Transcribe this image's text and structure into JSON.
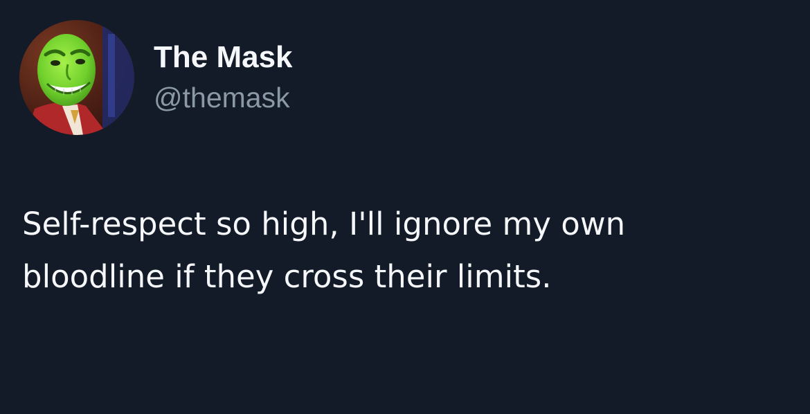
{
  "author": {
    "display_name": "The Mask",
    "handle": "@themask",
    "avatar_icon": "green-mask-face-avatar"
  },
  "tweet": {
    "text": "Self-respect so high, I'll ignore my own\nbloodline if they cross their limits."
  },
  "colors": {
    "background": "#131b28",
    "primary_text": "#f5f7fa",
    "secondary_text": "#8b98a5",
    "mask_green": "#7fd43a"
  }
}
